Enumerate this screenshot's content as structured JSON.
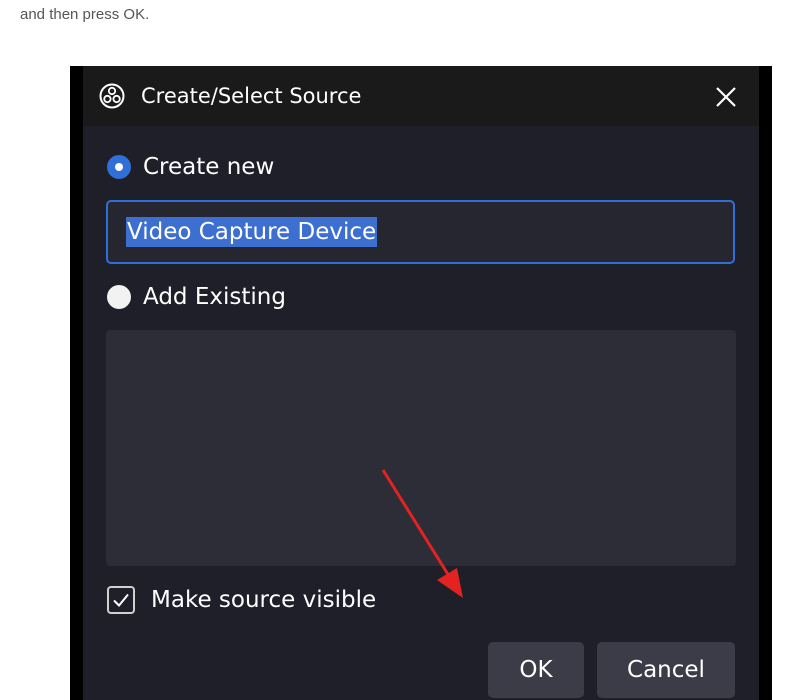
{
  "page": {
    "instruction_text": "and then press OK."
  },
  "dialog": {
    "title": "Create/Select Source",
    "icon": "obs-logo-icon",
    "close_icon": "close-icon",
    "create_new_label": "Create new",
    "source_name_value": "Video Capture Device",
    "add_existing_label": "Add Existing",
    "make_visible_label": "Make source visible",
    "ok_label": "OK",
    "cancel_label": "Cancel",
    "create_new_selected": true,
    "make_visible_checked": true
  },
  "annotation": {
    "arrow_color": "#e32222"
  },
  "colors": {
    "dialog_bg": "#1e1f28",
    "accent": "#2f6fd6",
    "list_bg": "#2c2d36",
    "button_bg": "#3b3c47"
  }
}
